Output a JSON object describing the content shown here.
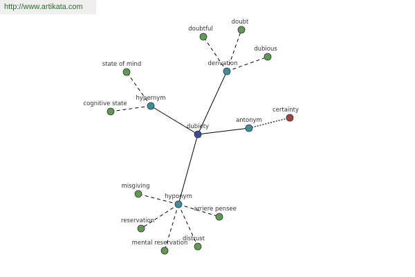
{
  "header": {
    "source_url": "http://www.artikata.com"
  },
  "colors": {
    "center": "#3b4aa0",
    "relation": "#3a8f9a",
    "term": "#5e9a52",
    "antonym_term": "#a84040",
    "edge": "#000000",
    "node_outline": "#333333"
  },
  "graph": {
    "nodes": [
      {
        "id": "dubiety",
        "label": "dubiety",
        "kind": "center"
      },
      {
        "id": "derivation",
        "label": "derivation",
        "kind": "relation"
      },
      {
        "id": "hypernym",
        "label": "hypernym",
        "kind": "relation"
      },
      {
        "id": "antonym",
        "label": "antonym",
        "kind": "relation"
      },
      {
        "id": "hyponym",
        "label": "hyponym",
        "kind": "relation"
      },
      {
        "id": "doubtful",
        "label": "doubtful",
        "kind": "term"
      },
      {
        "id": "doubt",
        "label": "doubt",
        "kind": "term"
      },
      {
        "id": "dubious",
        "label": "dubious",
        "kind": "term"
      },
      {
        "id": "state-of-mind",
        "label": "state of mind",
        "kind": "term"
      },
      {
        "id": "cognitive-state",
        "label": "cognitive state",
        "kind": "term"
      },
      {
        "id": "certainty",
        "label": "certainty",
        "kind": "antonym_term"
      },
      {
        "id": "misgiving",
        "label": "misgiving",
        "kind": "term"
      },
      {
        "id": "arriere-pensee",
        "label": "arriere pensee",
        "kind": "term"
      },
      {
        "id": "reservation",
        "label": "reservation",
        "kind": "term"
      },
      {
        "id": "mental-reservation",
        "label": "mental reservation",
        "kind": "term"
      },
      {
        "id": "distrust",
        "label": "distrust",
        "kind": "term"
      }
    ],
    "edges": [
      {
        "from": "dubiety",
        "to": "derivation",
        "style": "solid"
      },
      {
        "from": "dubiety",
        "to": "hypernym",
        "style": "solid"
      },
      {
        "from": "dubiety",
        "to": "antonym",
        "style": "solid"
      },
      {
        "from": "dubiety",
        "to": "hyponym",
        "style": "solid"
      },
      {
        "from": "derivation",
        "to": "doubtful",
        "style": "dashed"
      },
      {
        "from": "derivation",
        "to": "doubt",
        "style": "dashed"
      },
      {
        "from": "derivation",
        "to": "dubious",
        "style": "dashed"
      },
      {
        "from": "hypernym",
        "to": "state-of-mind",
        "style": "dashed"
      },
      {
        "from": "hypernym",
        "to": "cognitive-state",
        "style": "dashed"
      },
      {
        "from": "antonym",
        "to": "certainty",
        "style": "dotted"
      },
      {
        "from": "hyponym",
        "to": "misgiving",
        "style": "dashed"
      },
      {
        "from": "hyponym",
        "to": "arriere-pensee",
        "style": "dashed"
      },
      {
        "from": "hyponym",
        "to": "reservation",
        "style": "dashed"
      },
      {
        "from": "hyponym",
        "to": "mental-reservation",
        "style": "dashed"
      },
      {
        "from": "hyponym",
        "to": "distrust",
        "style": "dashed"
      }
    ]
  }
}
